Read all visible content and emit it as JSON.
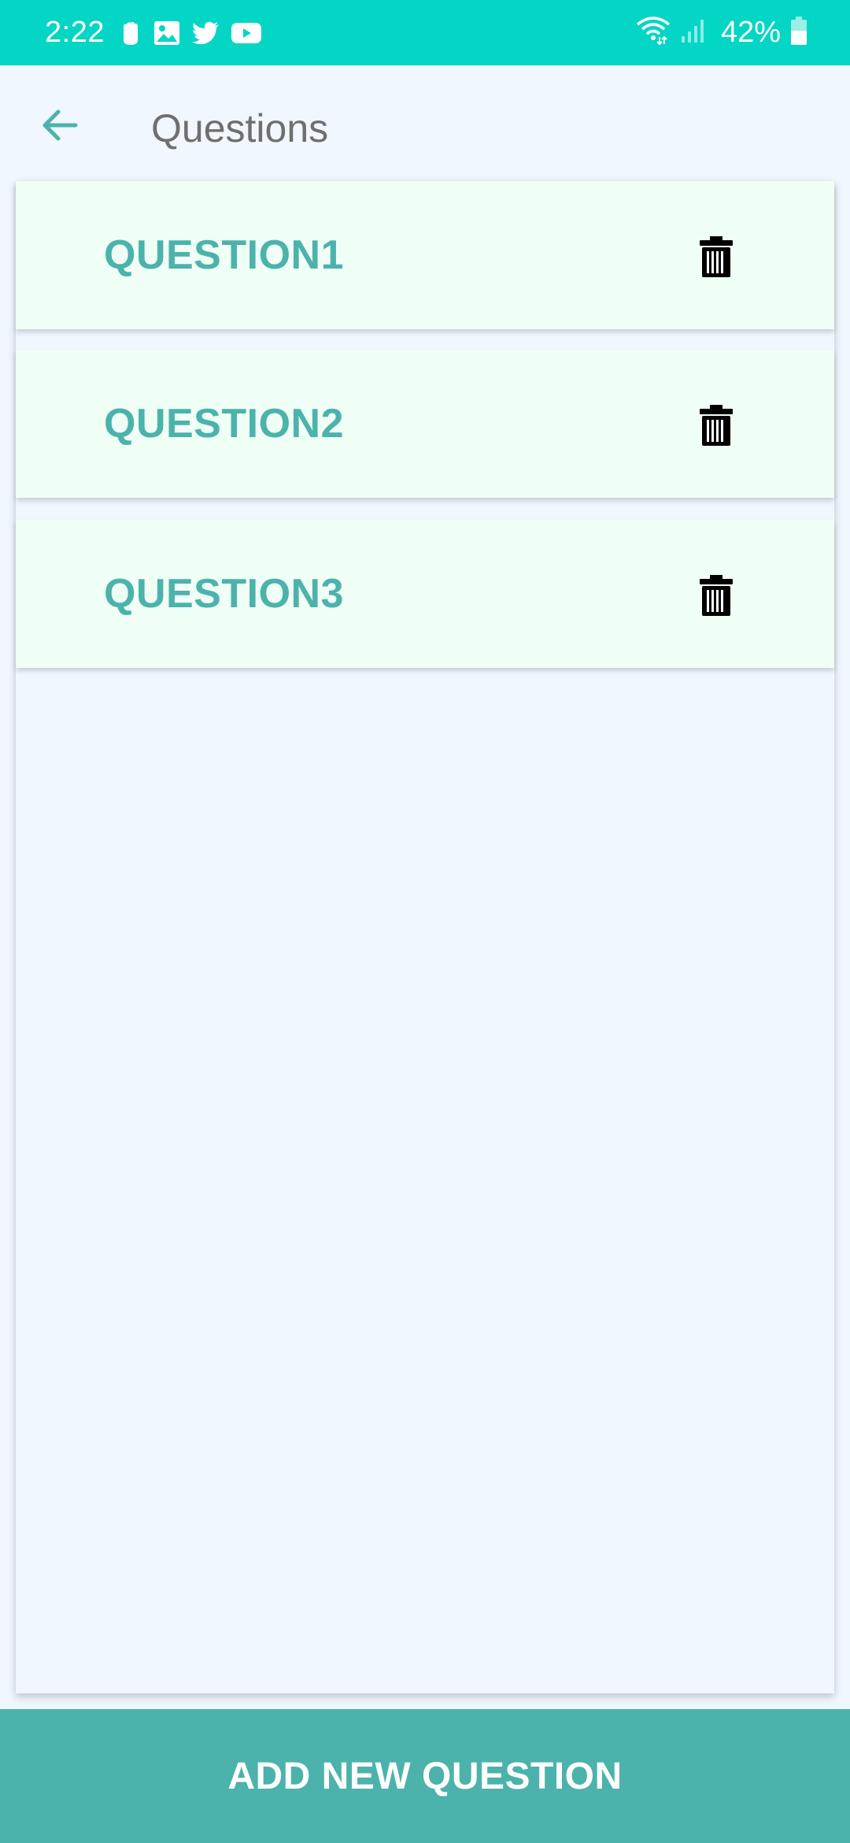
{
  "status_bar": {
    "time": "2:22",
    "battery_text": "42%",
    "icons_left": [
      "app-notification-icon",
      "gallery-icon",
      "twitter-icon",
      "youtube-icon"
    ],
    "icons_right": [
      "wifi-icon",
      "signal-icon",
      "battery-icon"
    ],
    "background_color": "#03d6c4"
  },
  "app_bar": {
    "back_icon": "arrow-left-icon",
    "title": "Questions"
  },
  "questions": [
    {
      "label": "QUESTION1",
      "action_icon": "trash-icon"
    },
    {
      "label": "QUESTION2",
      "action_icon": "trash-icon"
    },
    {
      "label": "QUESTION3",
      "action_icon": "trash-icon"
    }
  ],
  "footer": {
    "add_button_label": "ADD NEW QUESTION"
  },
  "colors": {
    "accent": "#4bb3ab",
    "card_background": "#f0fff5",
    "page_background": "#f0f7fe",
    "title_text": "#6f6f6f"
  }
}
